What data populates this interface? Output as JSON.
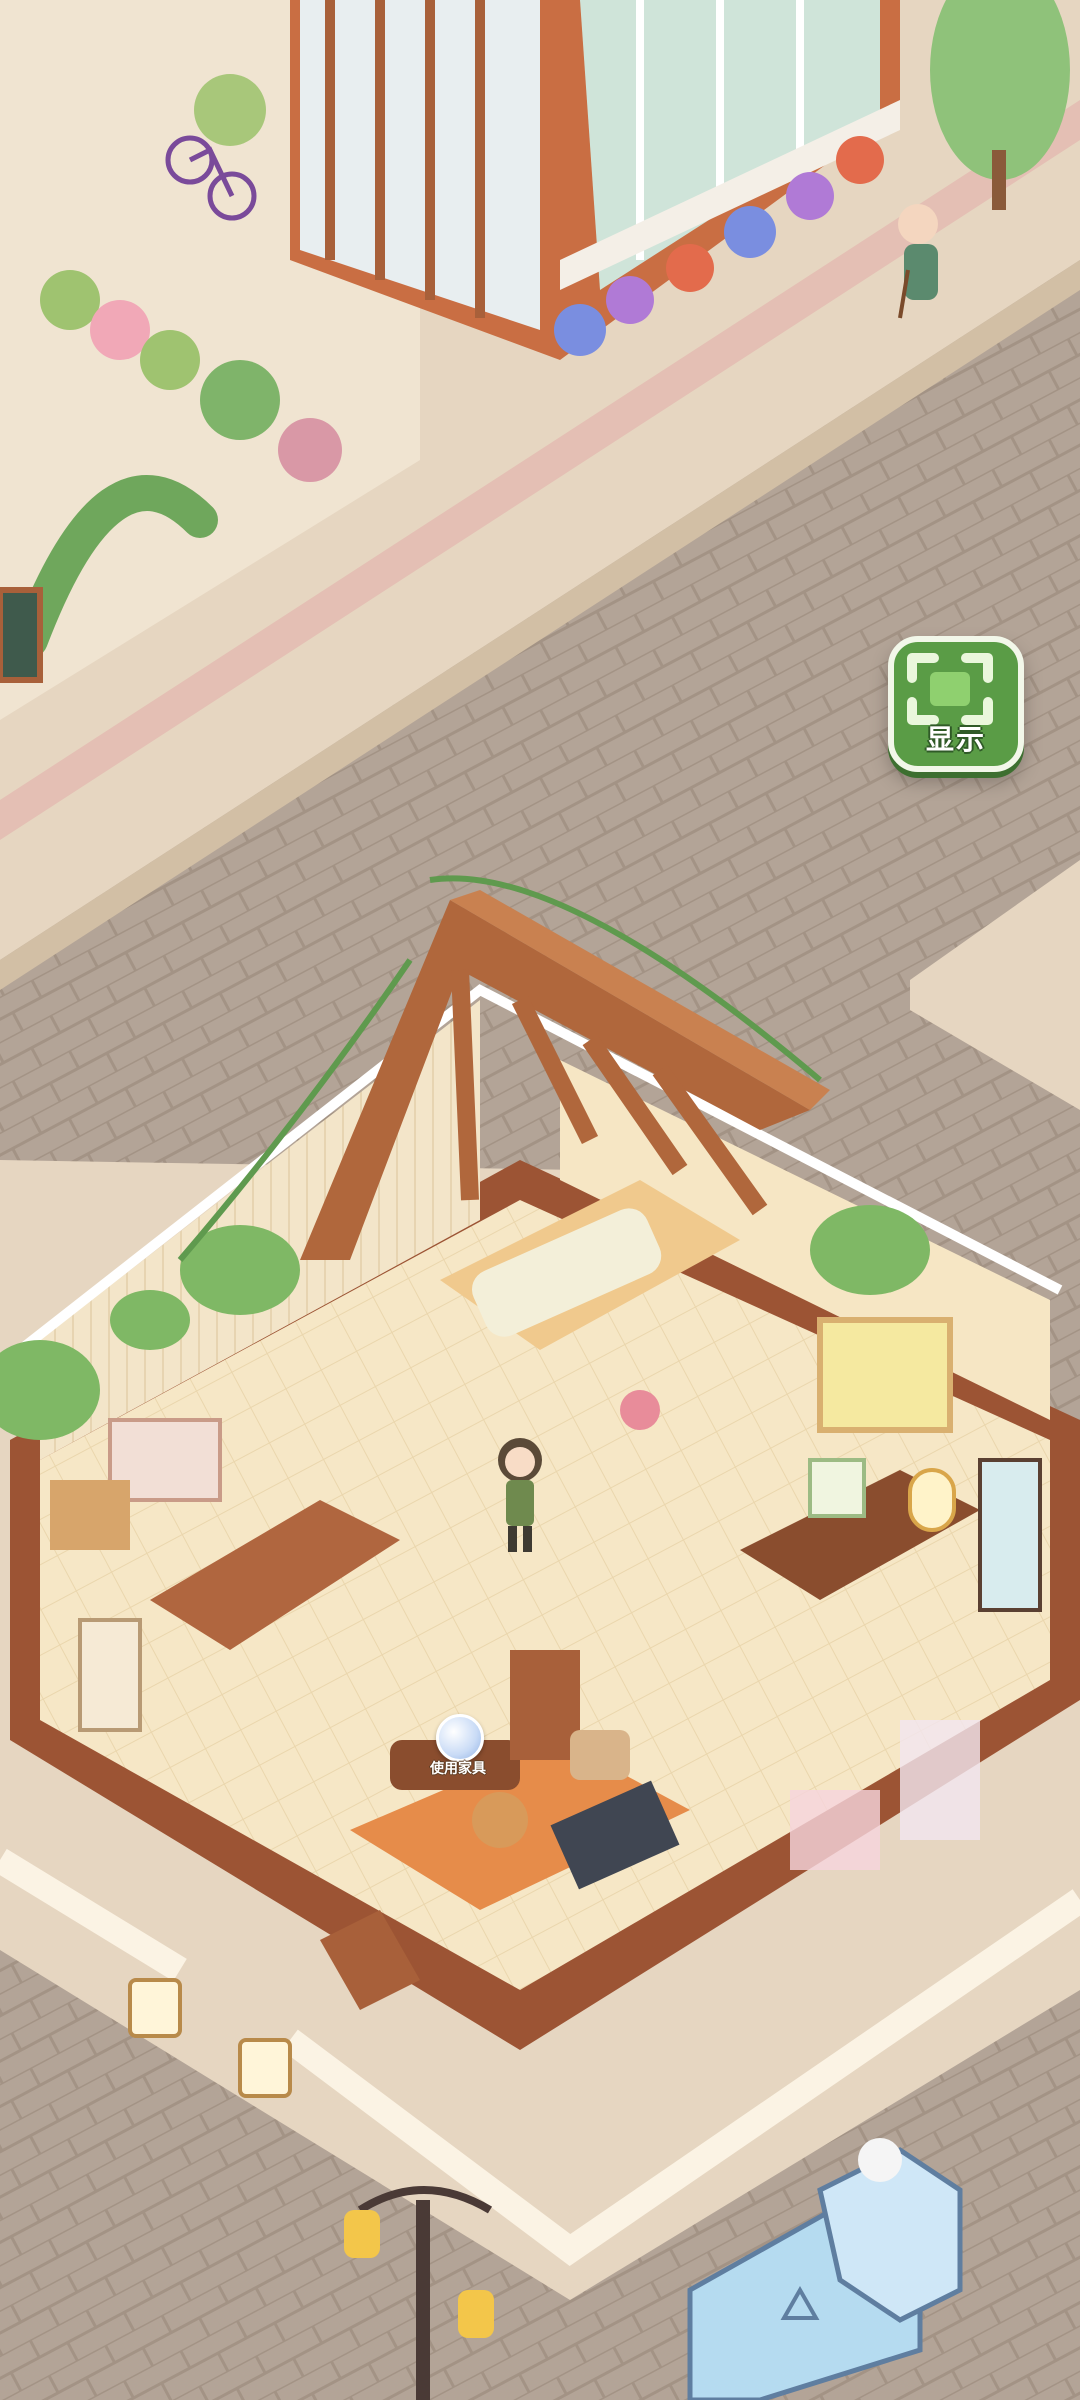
{
  "buttons": {
    "show_label": "显示",
    "use_furniture_label": "使用家具"
  },
  "icons": {
    "show": "frame-corners-icon",
    "use_furniture": "bubble-icon"
  },
  "colors": {
    "road": "#b3a497",
    "sidewalk": "#e6d6c1",
    "button_green": "#5a9c46",
    "wood": "#a8603a",
    "floor": "#f6e7c6"
  }
}
